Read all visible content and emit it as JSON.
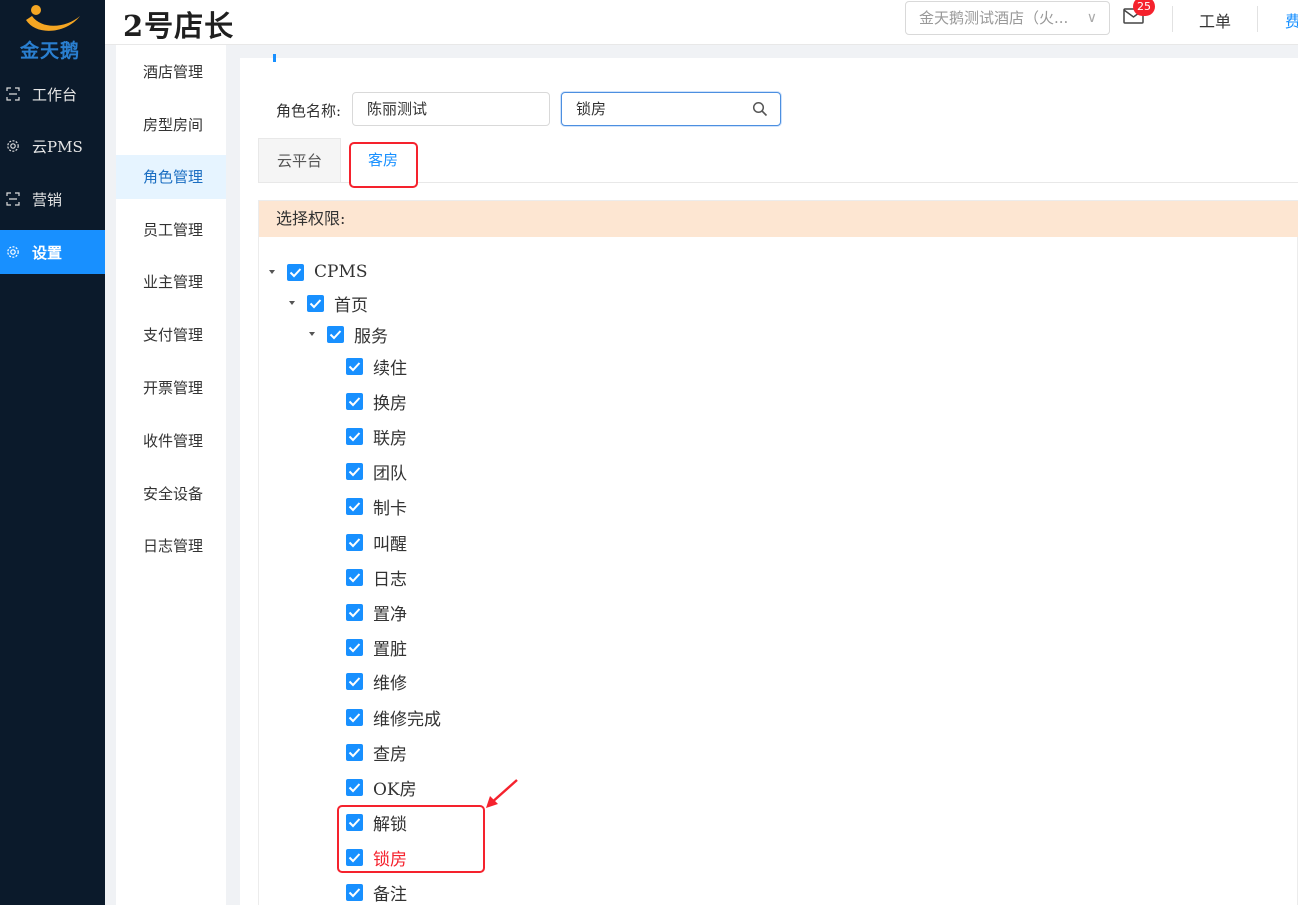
{
  "sidebar": {
    "logo_text": "金天鹅",
    "items": [
      {
        "label": "工作台",
        "icon": "workbench-icon"
      },
      {
        "label": "云PMS",
        "icon": "gear-icon"
      },
      {
        "label": "营销",
        "icon": "marketing-icon"
      },
      {
        "label": "设置",
        "icon": "gear-icon",
        "active": true
      }
    ]
  },
  "header": {
    "brand": "2号店长",
    "hotel_select": "金天鹅测试酒店（火...",
    "mail_badge": "25",
    "link_workorder": "工单",
    "link_fee": "费"
  },
  "submenu": {
    "items": [
      "酒店管理",
      "房型房间",
      "角色管理",
      "员工管理",
      "业主管理",
      "支付管理",
      "开票管理",
      "收件管理",
      "安全设备",
      "日志管理"
    ],
    "active_index": 2
  },
  "main": {
    "role_label": "角色名称:",
    "role_value": "陈丽测试",
    "search_value": "锁房",
    "tabs": [
      "云平台",
      "客房"
    ],
    "active_tab": 1,
    "perm_header": "选择权限:",
    "tree": [
      {
        "label": "CPMS",
        "level": 0,
        "caret": true
      },
      {
        "label": "首页",
        "level": 1,
        "caret": true
      },
      {
        "label": "服务",
        "level": 2,
        "caret": true
      },
      {
        "label": "续住",
        "level": 3
      },
      {
        "label": "换房",
        "level": 3
      },
      {
        "label": "联房",
        "level": 3
      },
      {
        "label": "团队",
        "level": 3
      },
      {
        "label": "制卡",
        "level": 3
      },
      {
        "label": "叫醒",
        "level": 3
      },
      {
        "label": "日志",
        "level": 3
      },
      {
        "label": "置净",
        "level": 3
      },
      {
        "label": "置脏",
        "level": 3
      },
      {
        "label": "维修",
        "level": 3
      },
      {
        "label": "维修完成",
        "level": 3
      },
      {
        "label": "查房",
        "level": 3
      },
      {
        "label": "OK房",
        "level": 3
      },
      {
        "label": "解锁",
        "level": 3
      },
      {
        "label": "锁房",
        "level": 3,
        "highlight": true
      },
      {
        "label": "备注",
        "level": 3
      }
    ]
  },
  "colors": {
    "primary": "#1890ff",
    "sidebar_bg": "#0b1a2b",
    "highlight_red": "#f5222d",
    "perm_header_bg": "#fde6d2"
  }
}
